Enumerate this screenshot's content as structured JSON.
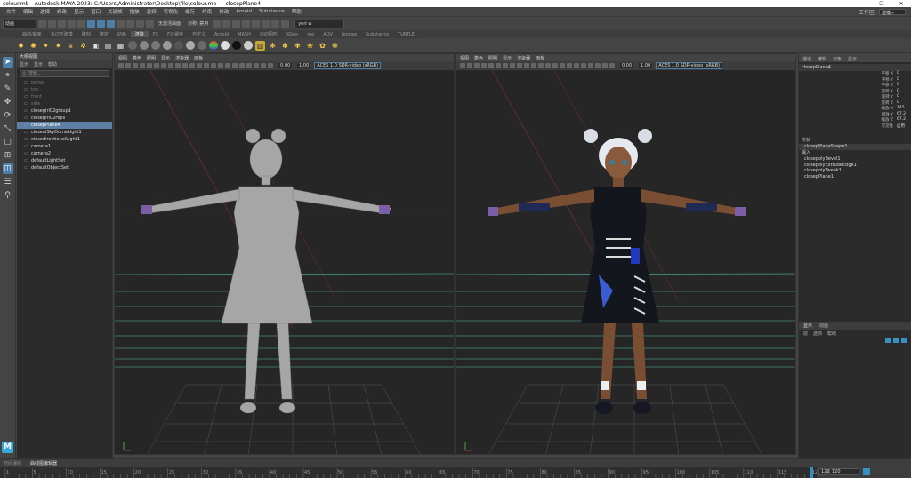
{
  "window": {
    "title": "colour.mb - Autodesk MAYA 2023: C:\\Users\\Administrator\\Desktop\\file\\colour.mb  ---  closepPlane4",
    "minimize": "—",
    "maximize": "☐",
    "close": "✕"
  },
  "menubar": {
    "items": [
      "文件",
      "编辑",
      "选择",
      "修改",
      "显示",
      "窗口",
      "关键帧",
      "播放",
      "音频",
      "可视化",
      "缓存",
      "约束",
      "修改",
      "Arnold",
      "Substance",
      "帮助"
    ],
    "workspace_label": "工作区:",
    "workspace_value": "建模>"
  },
  "statusline": {
    "mode": "动画",
    "symmetry": "对称: 禁用",
    "no_live": "无激活曲面",
    "camera": "yeri w"
  },
  "shelf_tabs": [
    "曲线/曲面",
    "多边形建模",
    "雕刻",
    "绑定",
    "动画",
    "渲染",
    "FX",
    "FX 缓存",
    "自定义",
    "Arnold",
    "MASH",
    "运动图形",
    "XGen",
    "mo",
    "ADV",
    "bonjaq",
    "Substance",
    "TURTLE"
  ],
  "shelf_active": "渲染",
  "outliner": {
    "title": "大纲视图",
    "menu": [
      "显示",
      "显示",
      "帮助"
    ],
    "search_placeholder": "搜索...",
    "rows": [
      {
        "label": "persp",
        "dim": true
      },
      {
        "label": "top",
        "dim": true
      },
      {
        "label": "front",
        "dim": true
      },
      {
        "label": "side",
        "dim": true
      },
      {
        "label": "closegirl02group1",
        "dim": false
      },
      {
        "label": "closegirl02Hips",
        "dim": false
      },
      {
        "label": "closepPlane4",
        "dim": false,
        "selected": true
      },
      {
        "label": "closeaiSkyDomeLight1",
        "dim": false
      },
      {
        "label": "closedirectionalLight1",
        "dim": false
      },
      {
        "label": "camera1",
        "dim": false
      },
      {
        "label": "camera2",
        "dim": false
      },
      {
        "label": "defaultLightSet",
        "dim": false
      },
      {
        "label": "defaultObjectSet",
        "dim": false
      }
    ]
  },
  "viewport": {
    "menu": [
      "视图",
      "着色",
      "照明",
      "显示",
      "渲染器",
      "面板"
    ],
    "near": "0.00",
    "far": "1.00",
    "aces": "ACES 1.0 SDR-video (sRGB)"
  },
  "attr_editor": {
    "tabs": [
      "通道",
      "编辑",
      "对象",
      "显示"
    ],
    "node_name": "closepPlane4",
    "channels": [
      {
        "label": "平移 X",
        "value": "0"
      },
      {
        "label": "平移 Y",
        "value": "0"
      },
      {
        "label": "平移 Z",
        "value": "0"
      },
      {
        "label": "旋转 X",
        "value": "0"
      },
      {
        "label": "旋转 Y",
        "value": "0"
      },
      {
        "label": "旋转 Z",
        "value": "0"
      },
      {
        "label": "缩放 X",
        "value": "145"
      },
      {
        "label": "缩放 Y",
        "value": "67.2"
      },
      {
        "label": "缩放 Z",
        "value": "67.2"
      },
      {
        "label": "可见性",
        "value": "启用"
      }
    ],
    "shapes_label": "形状",
    "shape_name": "closepPlaneShape1",
    "inputs_label": "输入",
    "inputs": [
      "closepolyBevel1",
      "closepolyExtrudeEdge1",
      "closepolyTweak1",
      "closepPlane1"
    ],
    "layer_tabs": [
      "显示",
      "动画"
    ],
    "layer_menu": [
      "层",
      "选项",
      "帮助"
    ]
  },
  "timeline": {
    "tabs": [
      "时间滑块",
      "曲线图编辑器"
    ],
    "ticks": [
      1,
      5,
      10,
      15,
      20,
      25,
      30,
      35,
      40,
      45,
      50,
      55,
      60,
      65,
      70,
      75,
      80,
      85,
      90,
      95,
      100,
      105,
      110,
      115,
      120
    ],
    "start": "1",
    "end": "120",
    "current": "120"
  },
  "colors": {
    "accent": "#4d7fa8",
    "selected_row": "#5d7fa3",
    "grid_line": "#4fb8a8"
  }
}
